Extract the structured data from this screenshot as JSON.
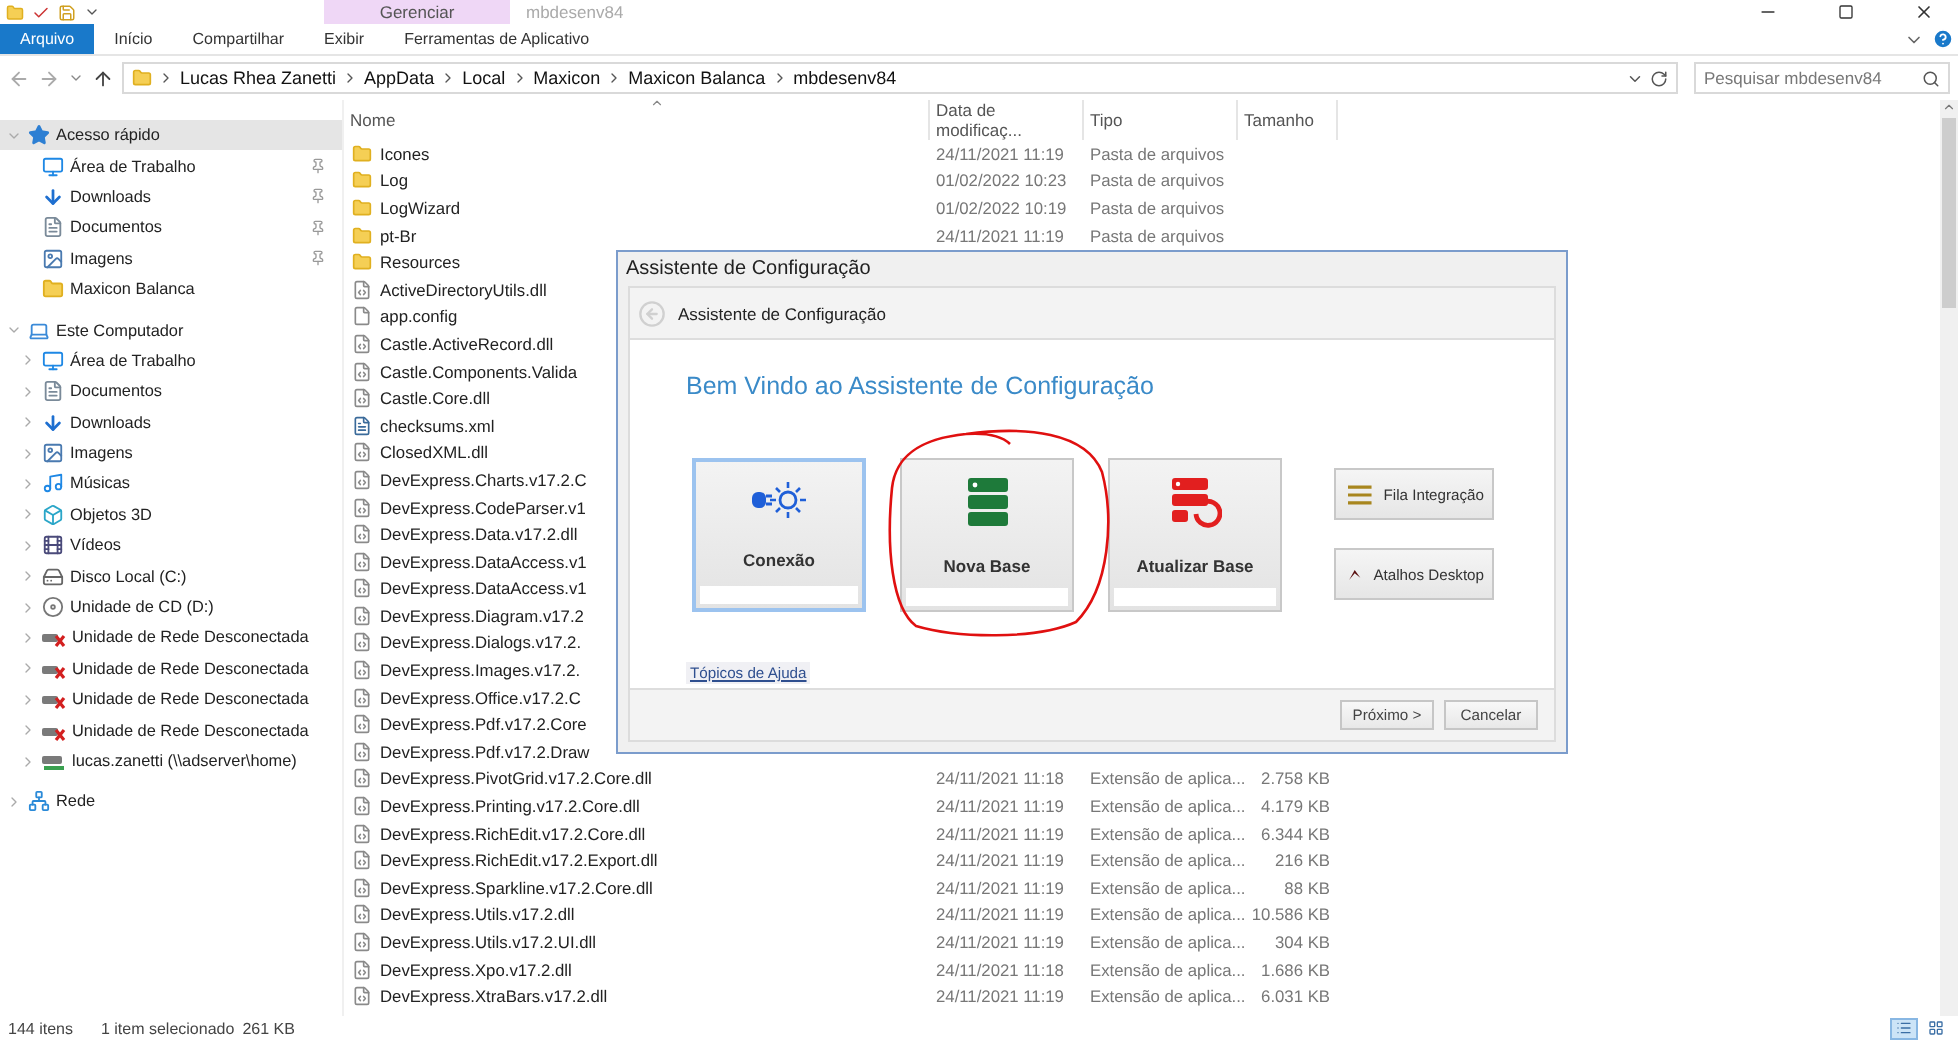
{
  "title_bar": {
    "context_tab": "Gerenciar",
    "title": "mbdesenv84"
  },
  "ribbon": {
    "tabs": [
      {
        "label": "Arquivo",
        "selected": true
      },
      {
        "label": "Início",
        "selected": false
      },
      {
        "label": "Compartilhar",
        "selected": false
      },
      {
        "label": "Exibir",
        "selected": false
      },
      {
        "label": "Ferramentas de Aplicativo",
        "selected": false
      }
    ]
  },
  "address": {
    "crumbs": [
      "Lucas Rhea Zanetti",
      "AppData",
      "Local",
      "Maxicon",
      "Maxicon Balanca",
      "mbdesenv84"
    ]
  },
  "search": {
    "placeholder": "Pesquisar mbdesenv84"
  },
  "sidebar": {
    "items": [
      {
        "label": "Acesso rápido",
        "kind": "star",
        "selected": true,
        "expanded": true,
        "children": [
          {
            "label": "Área de Trabalho",
            "kind": "desktop",
            "selected": false,
            "pinned": true
          },
          {
            "label": "Downloads",
            "kind": "download",
            "selected": false,
            "pinned": true
          },
          {
            "label": "Documentos",
            "kind": "document",
            "selected": false,
            "pinned": true
          },
          {
            "label": "Imagens",
            "kind": "image",
            "selected": false,
            "pinned": true
          },
          {
            "label": "Maxicon Balanca",
            "kind": "folder",
            "selected": false,
            "pinned": false
          }
        ]
      },
      {
        "label": "Este Computador",
        "kind": "computer",
        "selected": false,
        "expanded": true,
        "children": [
          {
            "label": "Área de Trabalho",
            "kind": "desktop",
            "selected": false,
            "expanded": false
          },
          {
            "label": "Documentos",
            "kind": "document",
            "selected": false,
            "expanded": false
          },
          {
            "label": "Downloads",
            "kind": "download",
            "selected": false,
            "expanded": false
          },
          {
            "label": "Imagens",
            "kind": "image",
            "selected": false,
            "expanded": false
          },
          {
            "label": "Músicas",
            "kind": "music",
            "selected": false,
            "expanded": false
          },
          {
            "label": "Objetos 3D",
            "kind": "cube",
            "selected": false,
            "expanded": false
          },
          {
            "label": "Vídeos",
            "kind": "video",
            "selected": false,
            "expanded": false
          },
          {
            "label": "Disco Local (C:)",
            "kind": "disk",
            "selected": false,
            "expanded": false
          },
          {
            "label": "Unidade de CD (D:)",
            "kind": "cd",
            "selected": false,
            "expanded": false
          },
          {
            "label": "Unidade de Rede Desconectada",
            "kind": "offline-drive",
            "selected": false,
            "expanded": false
          },
          {
            "label": "Unidade de Rede Desconectada",
            "kind": "offline-drive",
            "selected": false,
            "expanded": false
          },
          {
            "label": "Unidade de Rede Desconectada",
            "kind": "offline-drive",
            "selected": false,
            "expanded": false
          },
          {
            "label": "Unidade de Rede Desconectada",
            "kind": "offline-drive",
            "selected": false,
            "expanded": false
          },
          {
            "label": "lucas.zanetti (\\\\adserver\\home)",
            "kind": "network-drive",
            "selected": false,
            "expanded": false
          }
        ]
      },
      {
        "label": "Rede",
        "kind": "network",
        "selected": false,
        "expanded": false
      }
    ]
  },
  "table": {
    "columns": [
      "Nome",
      "Data de modificaç...",
      "Tipo",
      "Tamanho"
    ],
    "rows": [
      {
        "kind": "folder",
        "name": "Icones",
        "date": "24/11/2021 11:19",
        "type": "Pasta de arquivos"
      },
      {
        "kind": "folder",
        "name": "Log",
        "date": "01/02/2022 10:23",
        "type": "Pasta de arquivos"
      },
      {
        "kind": "folder",
        "name": "LogWizard",
        "date": "01/02/2022 10:19",
        "type": "Pasta de arquivos"
      },
      {
        "kind": "folder",
        "name": "pt-Br",
        "date": "24/11/2021 11:19",
        "type": "Pasta de arquivos"
      },
      {
        "kind": "folder",
        "name": "Resources"
      },
      {
        "kind": "dll",
        "name": "ActiveDirectoryUtils.dll"
      },
      {
        "kind": "file",
        "name": "app.config"
      },
      {
        "kind": "dll",
        "name": "Castle.ActiveRecord.dll"
      },
      {
        "kind": "dll",
        "name": "Castle.Components.Valida"
      },
      {
        "kind": "dll",
        "name": "Castle.Core.dll"
      },
      {
        "kind": "xml",
        "name": "checksums.xml"
      },
      {
        "kind": "dll",
        "name": "ClosedXML.dll"
      },
      {
        "kind": "dll",
        "name": "DevExpress.Charts.v17.2.C"
      },
      {
        "kind": "dll",
        "name": "DevExpress.CodeParser.v1"
      },
      {
        "kind": "dll",
        "name": "DevExpress.Data.v17.2.dll"
      },
      {
        "kind": "dll",
        "name": "DevExpress.DataAccess.v1"
      },
      {
        "kind": "dll",
        "name": "DevExpress.DataAccess.v1"
      },
      {
        "kind": "dll",
        "name": "DevExpress.Diagram.v17.2"
      },
      {
        "kind": "dll",
        "name": "DevExpress.Dialogs.v17.2."
      },
      {
        "kind": "dll",
        "name": "DevExpress.Images.v17.2."
      },
      {
        "kind": "dll",
        "name": "DevExpress.Office.v17.2.C"
      },
      {
        "kind": "dll",
        "name": "DevExpress.Pdf.v17.2.Core"
      },
      {
        "kind": "dll",
        "name": "DevExpress.Pdf.v17.2.Draw"
      },
      {
        "kind": "dll",
        "name": "DevExpress.PivotGrid.v17.2.Core.dll",
        "date": "24/11/2021 11:18",
        "type": "Extensão de aplica...",
        "size": "2.758 KB"
      },
      {
        "kind": "dll",
        "name": "DevExpress.Printing.v17.2.Core.dll",
        "date": "24/11/2021 11:19",
        "type": "Extensão de aplica...",
        "size": "4.179 KB"
      },
      {
        "kind": "dll",
        "name": "DevExpress.RichEdit.v17.2.Core.dll",
        "date": "24/11/2021 11:19",
        "type": "Extensão de aplica...",
        "size": "6.344 KB"
      },
      {
        "kind": "dll",
        "name": "DevExpress.RichEdit.v17.2.Export.dll",
        "date": "24/11/2021 11:19",
        "type": "Extensão de aplica...",
        "size": "216 KB"
      },
      {
        "kind": "dll",
        "name": "DevExpress.Sparkline.v17.2.Core.dll",
        "date": "24/11/2021 11:19",
        "type": "Extensão de aplica...",
        "size": "88 KB"
      },
      {
        "kind": "dll",
        "name": "DevExpress.Utils.v17.2.dll",
        "date": "24/11/2021 11:19",
        "type": "Extensão de aplica...",
        "size": "10.586 KB"
      },
      {
        "kind": "dll",
        "name": "DevExpress.Utils.v17.2.UI.dll",
        "date": "24/11/2021 11:19",
        "type": "Extensão de aplica...",
        "size": "304 KB"
      },
      {
        "kind": "dll",
        "name": "DevExpress.Xpo.v17.2.dll",
        "date": "24/11/2021 11:18",
        "type": "Extensão de aplica...",
        "size": "1.686 KB"
      },
      {
        "kind": "dll",
        "name": "DevExpress.XtraBars.v17.2.dll",
        "date": "24/11/2021 11:19",
        "type": "Extensão de aplica...",
        "size": "6.031 KB"
      }
    ]
  },
  "status_bar": {
    "count": "144 itens",
    "selection": "1 item selecionado",
    "size": "261 KB",
    "views": [
      {
        "kind": "details",
        "selected": true
      },
      {
        "kind": "tiles",
        "selected": false
      }
    ]
  },
  "dialog": {
    "title": "Assistente de Configuração",
    "header": "Assistente de Configuração",
    "heading": "Bem Vindo ao Assistente de Configuração",
    "tiles": [
      {
        "kind": "connection",
        "label": "Conexão",
        "selected": true
      },
      {
        "kind": "new-db",
        "label": "Nova Base",
        "selected": false
      },
      {
        "kind": "update-db",
        "label": "Atualizar Base",
        "selected": false
      }
    ],
    "side_buttons": [
      {
        "kind": "list",
        "label": "Fila Integração"
      },
      {
        "kind": "shortcut",
        "label": "Atalhos Desktop"
      }
    ],
    "link": "Tópicos de Ajuda",
    "buttons": [
      "Próximo >",
      "Cancelar"
    ]
  }
}
